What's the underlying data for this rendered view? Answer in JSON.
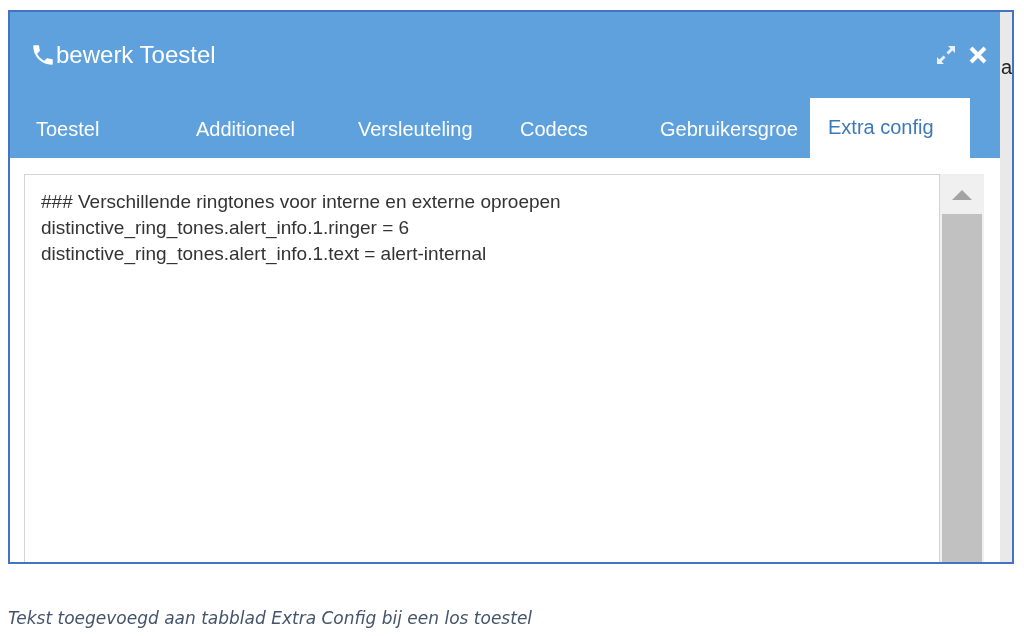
{
  "dialog": {
    "title": "bewerk Toestel",
    "tabs": [
      {
        "label": "Toestel",
        "selected": false
      },
      {
        "label": "Additioneel",
        "selected": false
      },
      {
        "label": "Versleuteling",
        "selected": false
      },
      {
        "label": "Codecs",
        "selected": false
      },
      {
        "label": "Gebruikersgroe",
        "selected": false
      },
      {
        "label": "Extra config",
        "selected": true
      }
    ],
    "editor": {
      "lines": [
        "### Verschillende ringtones voor interne en externe oproepen",
        "distinctive_ring_tones.alert_info.1.ringer = 6",
        "distinctive_ring_tones.alert_info.1.text = alert-internal"
      ]
    }
  },
  "background_fragment": "a",
  "caption": "Tekst toegevoegd aan tabblad Extra Config bij een los toestel"
}
